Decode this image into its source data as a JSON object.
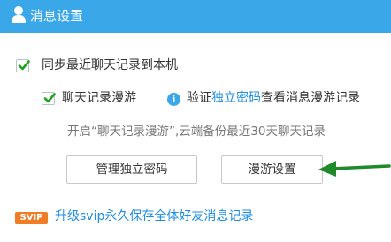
{
  "header": {
    "title": "消息设置",
    "icon": "user-icon",
    "color": "#3aa8e8"
  },
  "sync": {
    "label": "同步最近聊天记录到本机",
    "checked": true
  },
  "roaming": {
    "label": "聊天记录漫游",
    "checked": true,
    "info_prefix": "验证",
    "info_link": "独立密码",
    "info_suffix": "查看消息漫游记录",
    "description": "开启“聊天记录漫游”,云端备份最近30天聊天记录"
  },
  "buttons": {
    "manage_password": "管理独立密码",
    "roaming_settings": "漫游设置"
  },
  "svip": {
    "badge": "SVIP",
    "link": "升级svip永久保存全体好友消息记录"
  },
  "colors": {
    "link": "#1e8ee0",
    "check": "#1fa31f",
    "arrow": "#1f8a2a",
    "badge": "#f07d25"
  }
}
